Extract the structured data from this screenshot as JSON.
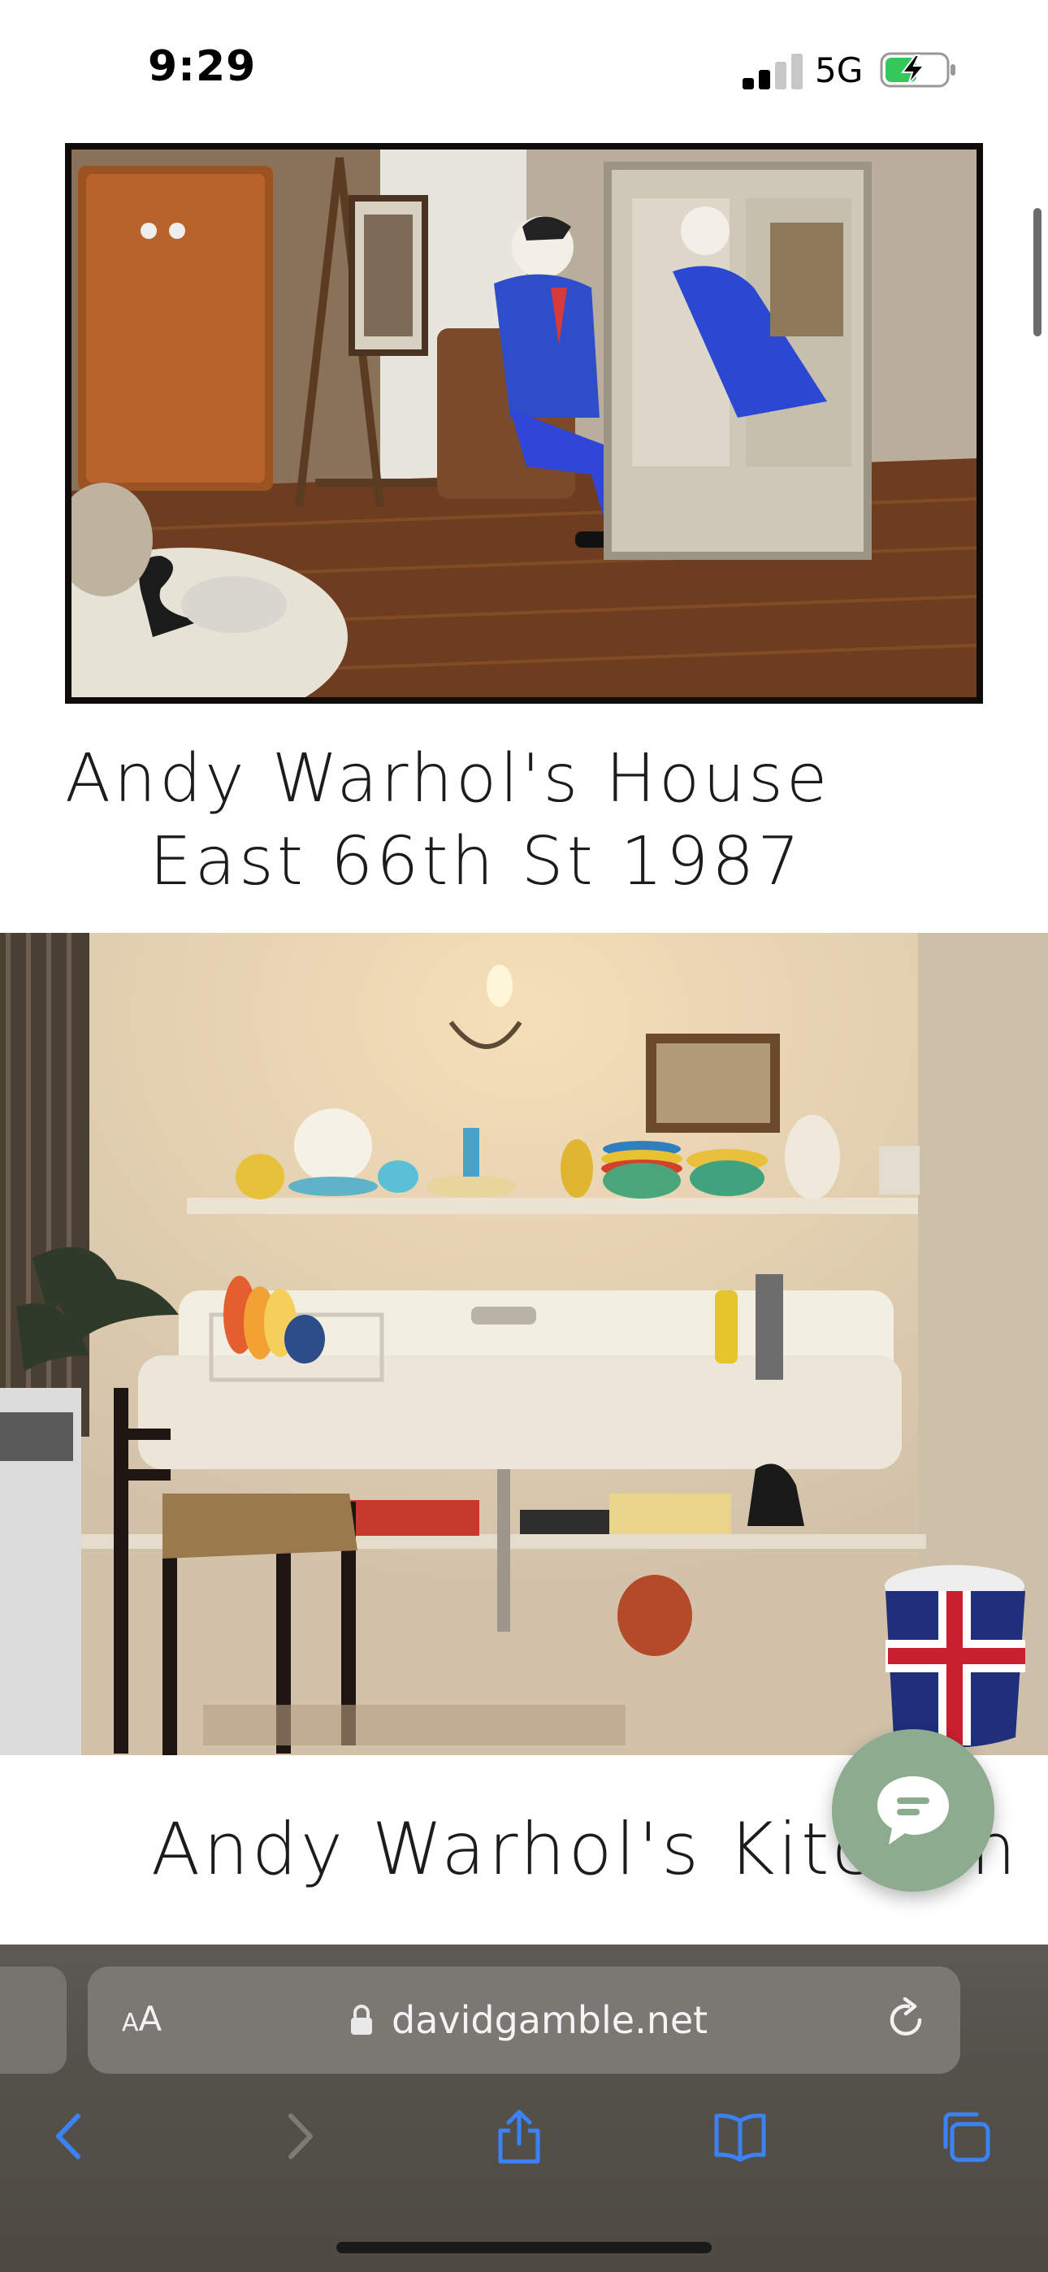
{
  "status_bar": {
    "time": "9:29",
    "network": "5G",
    "battery_charging": true
  },
  "gallery": [
    {
      "image_alt": "Andy Warhol's House, East 66th St 1987 — room with armchair, easel, mirrored cabinet and pop-art portrait figure",
      "caption_line1": "Andy Warhol's House",
      "caption_line2": "East 66th St 1987"
    },
    {
      "image_alt": "Andy Warhol's Kitchen — large white sink, shelf of colorful dishes, wall sconce, chair and Union Jack bin",
      "caption": "Andy Warhol's Kitchen"
    }
  ],
  "chat": {
    "icon": "chat-bubble-icon",
    "color": "#8cab8f"
  },
  "browser": {
    "text_size_label_small": "A",
    "text_size_label_big": "A",
    "url": "davidgamble.net",
    "accent": "#3b82f6"
  }
}
